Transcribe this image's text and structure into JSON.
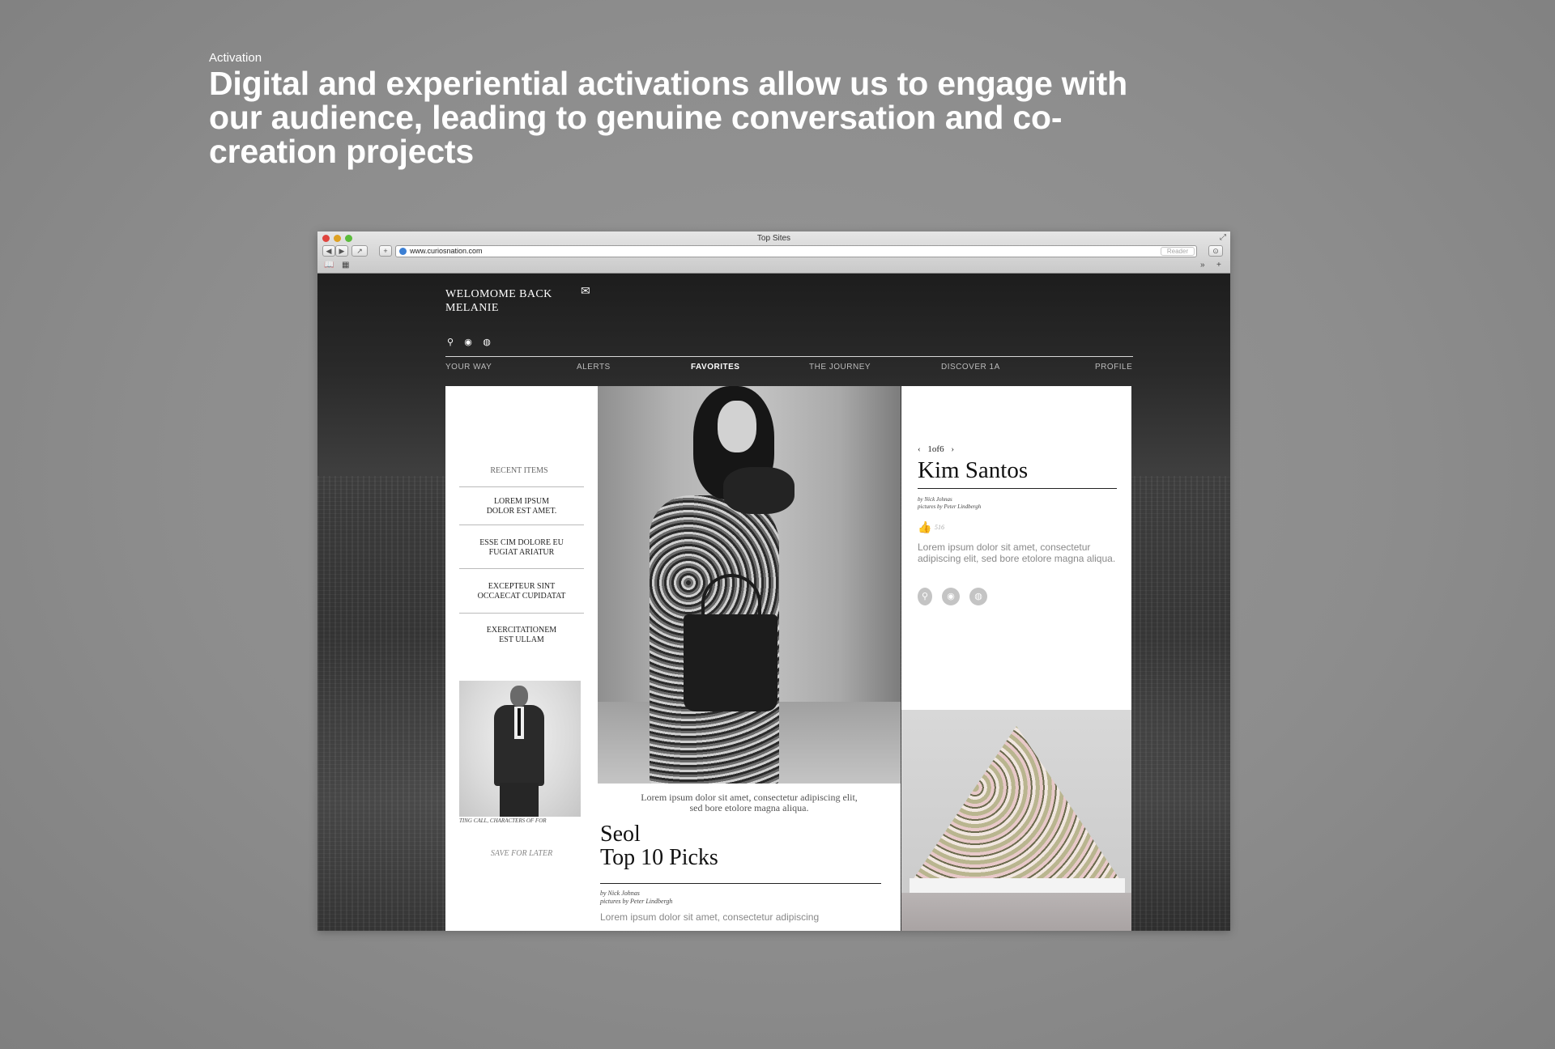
{
  "slide": {
    "kicker": "Activation",
    "headline": "Digital and experiential activations allow us to engage with our audience, leading to genuine conversation and co-creation projects"
  },
  "browser": {
    "window_title": "Top Sites",
    "url": "www.curiosnation.com",
    "reader_label": "Reader",
    "back_glyph": "◀",
    "forward_glyph": "▶",
    "share_glyph": "↗",
    "add_glyph": "+",
    "more_glyph": "»"
  },
  "site": {
    "welcome_line1": "WELOMOME BACK",
    "welcome_line2": "MELANIE",
    "nav": [
      "YOUR WAY",
      "ALERTS",
      "FAVORITES",
      "THE JOURNEY",
      "DISCOVER 1A",
      "PROFILE"
    ],
    "active_nav": "FAVORITES",
    "recent": {
      "title": "RECENT ITEMS",
      "items": [
        [
          "LOREM IPSUM",
          "DOLOR EST AMET."
        ],
        [
          "ESSE CIM DOLORE EU",
          "FUGIAT ARIATUR"
        ],
        [
          "EXCEPTEUR SINT",
          "OCCAECAT CUPIDATAT"
        ],
        [
          "EXERCITATIONEM",
          "EST ULLAM"
        ]
      ],
      "photo_caption": "TING CALL, CHARACTERS OF FOR",
      "save_label": "SAVE FOR LATER"
    },
    "feature": {
      "blurb_line1": "Lorem ipsum dolor sit amet, consectetur adipiscing elit,",
      "blurb_line2": "sed bore etolore magna aliqua.",
      "title_line1": "Seol",
      "title_line2": "Top 10 Picks",
      "by_line": "by Nick Johnas",
      "pictures_line": "pictures by Peter Lindbergh",
      "body": "Lorem ipsum dolor sit amet, consectetur adipiscing"
    },
    "profile": {
      "pager": "1of6",
      "prev": "‹",
      "next": "›",
      "name": "Kim Santos",
      "by_line": "by Nick Johnas",
      "pictures_line": "pictures by Peter Lindbergh",
      "likes": "516",
      "body": "Lorem ipsum dolor sit amet, consectetur adipiscing elit, sed bore etolore magna aliqua."
    }
  },
  "icons": {
    "mail": "envelope-icon",
    "location": "location-pin-icon",
    "group": "group-icon",
    "globe": "globe-icon",
    "like": "thumbs-up-icon"
  },
  "colors": {
    "slide_bg": "#8d8d8d",
    "page_bg": "#2b2b2b",
    "text_white": "#ffffff"
  }
}
